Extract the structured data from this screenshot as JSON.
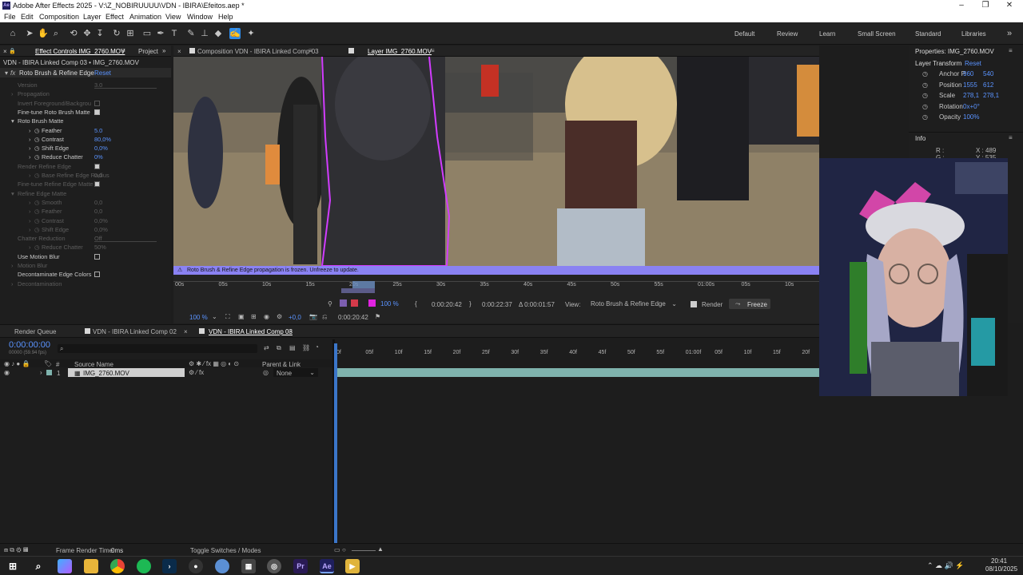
{
  "window": {
    "title": "Adobe After Effects 2025 - V:\\Z_NOBIRUUUU\\VDN - IBIRA\\Efeitos.aep *",
    "app_icon": "Ae"
  },
  "menu": [
    "File",
    "Edit",
    "Composition",
    "Layer",
    "Effect",
    "Animation",
    "View",
    "Window",
    "Help"
  ],
  "workspaces": [
    "Default",
    "Review",
    "Learn",
    "Small Screen",
    "Standard",
    "Libraries"
  ],
  "left_panel": {
    "tab": "Effect Controls IMG_2760.MOV",
    "tab2": "Project",
    "header": "VDN - IBIRA Linked Comp 03 • IMG_2760.MOV",
    "fx_name": "Roto Brush & Refine Edge",
    "reset": "Reset",
    "props": [
      {
        "label": "Version",
        "value": "3.0",
        "dim": true,
        "type": "dd"
      },
      {
        "label": "Propagation",
        "dim": true,
        "type": "group"
      },
      {
        "label": "Invert Foreground/Backgrou",
        "dim": true,
        "type": "check",
        "on": false
      },
      {
        "label": "Fine-tune Roto Brush Matte",
        "dim": false,
        "type": "check",
        "on": true
      },
      {
        "label": "Roto Brush Matte",
        "dim": false,
        "type": "open"
      },
      {
        "label": "Feather",
        "value": "5.0",
        "dim": false,
        "type": "val"
      },
      {
        "label": "Contrast",
        "value": "80,0%",
        "dim": false,
        "type": "val"
      },
      {
        "label": "Shift Edge",
        "value": "0,0%",
        "dim": false,
        "type": "val"
      },
      {
        "label": "Reduce Chatter",
        "value": "0%",
        "dim": false,
        "type": "val"
      },
      {
        "label": "Render Refine Edge",
        "dim": true,
        "type": "check",
        "on": true
      },
      {
        "label": "Base Refine Edge Radius",
        "value": "0,0",
        "dim": true,
        "type": "val"
      },
      {
        "label": "Fine-tune Refine Edge Matte",
        "dim": true,
        "type": "check",
        "on": true
      },
      {
        "label": "Refine Edge Matte",
        "dim": true,
        "type": "open"
      },
      {
        "label": "Smooth",
        "value": "0,0",
        "dim": true,
        "type": "val"
      },
      {
        "label": "Feather",
        "value": "0,0",
        "dim": true,
        "type": "val"
      },
      {
        "label": "Contrast",
        "value": "0,0%",
        "dim": true,
        "type": "val"
      },
      {
        "label": "Shift Edge",
        "value": "0,0%",
        "dim": true,
        "type": "val"
      },
      {
        "label": "Chatter Reduction",
        "value": "Off",
        "dim": true,
        "type": "dd"
      },
      {
        "label": "Reduce Chatter",
        "value": "50%",
        "dim": true,
        "type": "val"
      },
      {
        "label": "Use Motion Blur",
        "dim": false,
        "type": "check",
        "on": false
      },
      {
        "label": "Motion Blur",
        "dim": true,
        "type": "group"
      },
      {
        "label": "Decontaminate Edge Colors",
        "dim": false,
        "type": "check",
        "on": false
      },
      {
        "label": "Decontamination",
        "dim": true,
        "type": "group"
      }
    ]
  },
  "viewer": {
    "tab_comp": "Composition VDN - IBIRA Linked Comp 03",
    "tab_layer": "Layer IMG_2760.MOV",
    "warning": "Roto Brush & Refine Edge propagation is frozen. Unfreeze to update.",
    "ruler": [
      "00s",
      "05s",
      "10s",
      "15s",
      "20s",
      "25s",
      "30s",
      "35s",
      "40s",
      "45s",
      "50s",
      "55s",
      "01:00s",
      "05s",
      "10s"
    ],
    "time_current": "0:00:20:42",
    "time_end": "0:00:22:37",
    "time_delta": "Δ 0:00:01:57",
    "view_label": "View:",
    "view_value": "Roto Brush & Refine Edge",
    "render_label": "Render",
    "freeze_label": "Freeze",
    "zoom": "100 %",
    "exposure": "+0,0",
    "bottom_time": "0:00:20:42",
    "res": "100 %"
  },
  "right_panel": {
    "title": "Properties: IMG_2760.MOV",
    "section": "Layer Transform",
    "reset": "Reset",
    "props": [
      {
        "label": "Anchor P.",
        "v1": "960",
        "v2": "540"
      },
      {
        "label": "Position",
        "v1": "1555",
        "v2": "612"
      },
      {
        "label": "Scale",
        "v1": "278,1",
        "v2": "278,1"
      },
      {
        "label": "Rotation",
        "v1": "0x+0°",
        "v2": ""
      },
      {
        "label": "Opacity",
        "v1": "100%",
        "v2": ""
      }
    ],
    "info_title": "Info",
    "info_r": "R :",
    "info_g": "G :",
    "info_x": "X : 489",
    "info_y": "Y : 535"
  },
  "timeline": {
    "tabs": [
      "Render Queue",
      "VDN - IBIRA Linked Comp 02",
      "VDN - IBIRA Linked Comp 03"
    ],
    "timecode": "0:00:00:00",
    "fps": "00000 (59.94 fps)",
    "search_placeholder": "",
    "col_num": "#",
    "col_source": "Source Name",
    "col_parent": "Parent & Link",
    "layer_num": "1",
    "layer_name": "IMG_2760.MOV",
    "parent_value": "None",
    "ruler": [
      "0f",
      "05f",
      "10f",
      "15f",
      "20f",
      "25f",
      "30f",
      "35f",
      "40f",
      "45f",
      "50f",
      "55f",
      "01:00f",
      "05f",
      "10f",
      "15f",
      "20f"
    ],
    "render_time_label": "Frame Render Time:",
    "render_time_value": "0ms",
    "toggle_label": "Toggle Switches / Modes"
  },
  "taskbar": {
    "time": "20:41",
    "date": "08/10/2025",
    "apps": [
      "search",
      "copilot",
      "explorer",
      "chrome",
      "spotify",
      "terminal",
      "obs",
      "browser",
      "media",
      "vscode",
      "Pr",
      "Ae",
      "app"
    ]
  },
  "colors": {
    "accent": "#2d8ceb",
    "matte_outline": "#d23cff",
    "warning_bar": "#8a82f3",
    "value_blue": "#5a93ff",
    "layer_bar": "#7fb3ad"
  }
}
